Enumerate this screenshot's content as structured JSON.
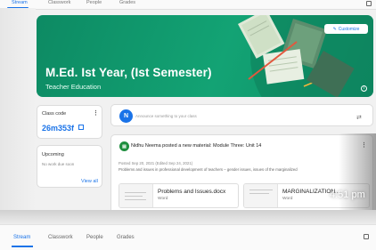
{
  "top_tabs": [
    {
      "label": "Stream"
    },
    {
      "label": "Classwork"
    },
    {
      "label": "People"
    },
    {
      "label": "Grades"
    }
  ],
  "banner": {
    "title": "M.Ed. Ist Year, (Ist Semester)",
    "subtitle": "Teacher Education",
    "customize_label": "Customize",
    "accent": "#13a374"
  },
  "class_code": {
    "label": "Class code",
    "value": "26m353f"
  },
  "upcoming": {
    "label": "Upcoming",
    "empty_text": "No work due soon",
    "view_all": "View all"
  },
  "announce": {
    "avatar_letter": "N",
    "placeholder": "Announce something to your class"
  },
  "material": {
    "title": "Nidhu Neema posted a new material: Module Three: Unit 14",
    "date": "Posted Sep 20, 2021 (Edited Sep 24, 2021)",
    "description": "Problems and issues in professional development of teachers – gender issues, issues of the marginalized",
    "attachments": [
      {
        "name": "Problems and Issues.docx",
        "type": "Word"
      },
      {
        "name": "MARGINALIZATION...",
        "type": "Word"
      }
    ]
  },
  "time_overlay": "4:51 pm",
  "bottom_tabs": [
    {
      "label": "Stream"
    },
    {
      "label": "Classwork"
    },
    {
      "label": "People"
    },
    {
      "label": "Grades"
    }
  ],
  "colors": {
    "brand_blue": "#1a73e8",
    "banner_green": "#0d8a63",
    "avatar_blue": "#1a73e8",
    "material_green": "#1e8e3e"
  }
}
